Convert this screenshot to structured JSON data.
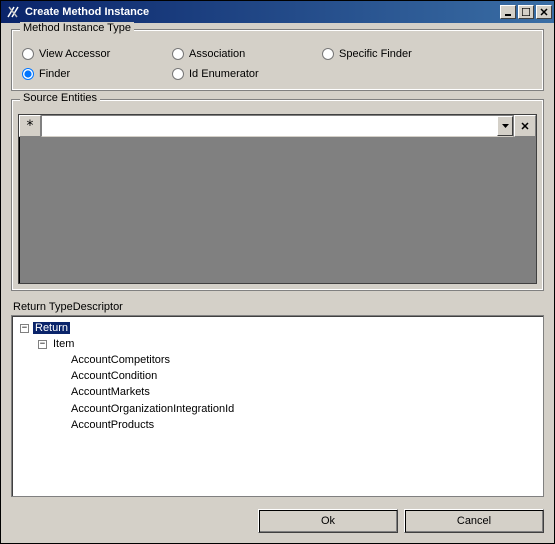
{
  "window": {
    "title": "Create Method Instance"
  },
  "groups": {
    "method_instance_type": {
      "legend": "Method Instance Type",
      "radios": {
        "view_accessor": {
          "label": "View Accessor",
          "checked": false
        },
        "association": {
          "label": "Association",
          "checked": false
        },
        "specific_finder": {
          "label": "Specific Finder",
          "checked": false
        },
        "finder": {
          "label": "Finder",
          "checked": true
        },
        "id_enumerator": {
          "label": "Id Enumerator",
          "checked": false
        }
      }
    },
    "source_entities": {
      "legend": "Source Entities",
      "new_row_marker": "*"
    }
  },
  "return_descriptor": {
    "label": "Return TypeDescriptor",
    "tree": {
      "root": {
        "label": "Return",
        "children_key": "item"
      },
      "item": {
        "label": "Item",
        "children": [
          "AccountCompetitors",
          "AccountCondition",
          "AccountMarkets",
          "AccountOrganizationIntegrationId",
          "AccountProducts"
        ]
      }
    }
  },
  "buttons": {
    "ok": "Ok",
    "cancel": "Cancel"
  }
}
